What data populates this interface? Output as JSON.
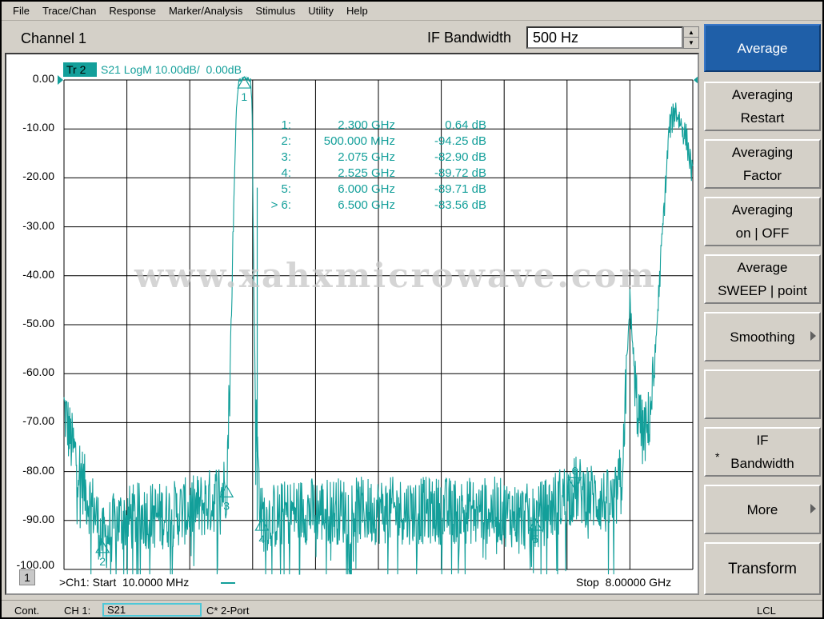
{
  "menu": [
    "File",
    "Trace/Chan",
    "Response",
    "Marker/Analysis",
    "Stimulus",
    "Utility",
    "Help"
  ],
  "header": {
    "channel_title": "Channel 1",
    "ifbw_label": "IF Bandwidth",
    "ifbw_value": "500 Hz"
  },
  "trace": {
    "tag": "Tr 2",
    "description": "S21 LogM 10.00dB/  0.00dB",
    "color": "#139f9a"
  },
  "y_axis": {
    "ticks": [
      "0.00",
      "-10.00",
      "-20.00",
      "-30.00",
      "-40.00",
      "-50.00",
      "-60.00",
      "-70.00",
      "-80.00",
      "-90.00",
      "-100.00"
    ],
    "scale_db_per_div": 10,
    "reference_db": 0,
    "range": [
      -100,
      0
    ]
  },
  "x_axis": {
    "start_label": ">Ch1: Start  10.0000 MHz",
    "stop_label": "Stop  8.00000 GHz",
    "range_ghz": [
      0.01,
      8.0
    ]
  },
  "channel_number": "1",
  "markers": [
    {
      "id": "1:",
      "freq": "2.300 GHz",
      "value": "0.64 dB",
      "label": "1"
    },
    {
      "id": "2:",
      "freq": "500.000 MHz",
      "value": "-94.25 dB",
      "label": "2"
    },
    {
      "id": "3:",
      "freq": "2.075 GHz",
      "value": "-82.90 dB",
      "label": "3"
    },
    {
      "id": "4:",
      "freq": "2.525 GHz",
      "value": "-89.72 dB",
      "label": "4"
    },
    {
      "id": "5:",
      "freq": "6.000 GHz",
      "value": "-89.71 dB",
      "label": "5"
    },
    {
      "id": "> 6:",
      "freq": "6.500 GHz",
      "value": "-83.56 dB",
      "label": "6"
    }
  ],
  "watermark": "www.xahxmicrowave.com",
  "softkeys": [
    {
      "label": "Average",
      "active": true
    },
    {
      "label": "Averaging\nRestart"
    },
    {
      "label": "Averaging\nFactor"
    },
    {
      "label": "Averaging\non | OFF"
    },
    {
      "label": "Average\nSWEEP | point"
    },
    {
      "label": "Smoothing",
      "arrow": true
    },
    {
      "label": ""
    },
    {
      "label": "IF\nBandwidth",
      "star": "*"
    },
    {
      "label": "More",
      "arrow": true
    },
    {
      "label": "Transform"
    }
  ],
  "status": {
    "mode": "Cont.",
    "channel": "CH 1:",
    "measurement": "S21",
    "calibration": "C* 2-Port",
    "reference": "LCL"
  },
  "chart_data": {
    "type": "line",
    "xlabel": "",
    "ylabel": "",
    "xlim_ghz": [
      0.01,
      8.0
    ],
    "ylim": [
      -100,
      0
    ],
    "grid": true,
    "series": [
      {
        "name": "S21",
        "points_ghz_db": [
          [
            0.01,
            -67
          ],
          [
            0.1,
            -74
          ],
          [
            0.2,
            -79
          ],
          [
            0.3,
            -85
          ],
          [
            0.4,
            -88
          ],
          [
            0.5,
            -94.25
          ],
          [
            0.7,
            -90
          ],
          [
            1.0,
            -89
          ],
          [
            1.3,
            -89
          ],
          [
            1.6,
            -88
          ],
          [
            1.9,
            -86
          ],
          [
            2.0,
            -84
          ],
          [
            2.075,
            -82.9
          ],
          [
            2.12,
            -60
          ],
          [
            2.16,
            -30
          ],
          [
            2.2,
            -6
          ],
          [
            2.23,
            0
          ],
          [
            2.3,
            0.64
          ],
          [
            2.38,
            0
          ],
          [
            2.4,
            -5
          ],
          [
            2.42,
            -40
          ],
          [
            2.45,
            -70
          ],
          [
            2.5,
            -86
          ],
          [
            2.525,
            -89.72
          ],
          [
            3.0,
            -88
          ],
          [
            3.5,
            -88
          ],
          [
            4.0,
            -88
          ],
          [
            4.5,
            -88
          ],
          [
            5.0,
            -88
          ],
          [
            5.5,
            -88
          ],
          [
            6.0,
            -89.71
          ],
          [
            6.5,
            -83.56
          ],
          [
            7.0,
            -87
          ],
          [
            7.1,
            -80
          ],
          [
            7.2,
            -45
          ],
          [
            7.28,
            -65
          ],
          [
            7.35,
            -72
          ],
          [
            7.42,
            -72
          ],
          [
            7.5,
            -62
          ],
          [
            7.6,
            -35
          ],
          [
            7.7,
            -10
          ],
          [
            7.78,
            -6
          ],
          [
            7.85,
            -9
          ],
          [
            7.92,
            -12
          ],
          [
            8.0,
            -20
          ]
        ]
      }
    ]
  }
}
